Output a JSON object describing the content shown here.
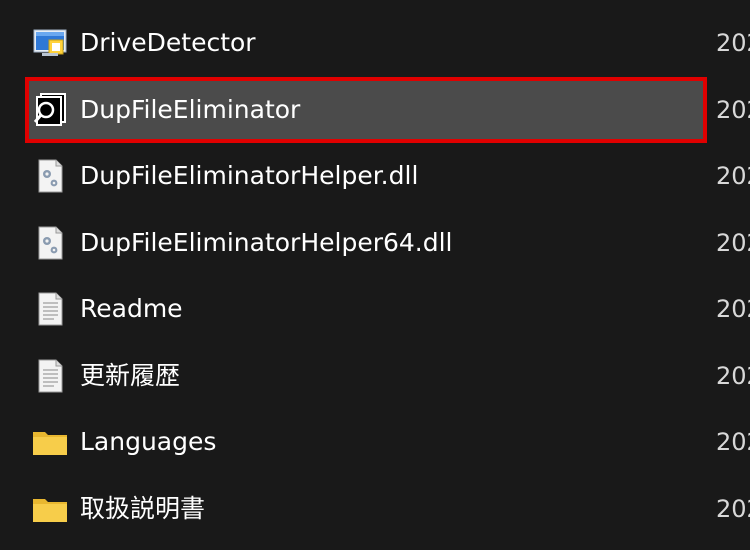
{
  "files": [
    {
      "name": "DriveDetector",
      "date": "202",
      "icon": "drive-detector-app-icon",
      "selected": false
    },
    {
      "name": "DupFileEliminator",
      "date": "202",
      "icon": "dupfileeliminator-app-icon",
      "selected": true
    },
    {
      "name": "DupFileEliminatorHelper.dll",
      "date": "202",
      "icon": "dll-gear-icon",
      "selected": false
    },
    {
      "name": "DupFileEliminatorHelper64.dll",
      "date": "202",
      "icon": "dll-gear-icon",
      "selected": false
    },
    {
      "name": "Readme",
      "date": "202",
      "icon": "text-file-icon",
      "selected": false
    },
    {
      "name": "更新履歴",
      "date": "202",
      "icon": "text-file-icon",
      "selected": false
    },
    {
      "name": "Languages",
      "date": "202",
      "icon": "folder-icon",
      "selected": false
    },
    {
      "name": "取扱説明書",
      "date": "202",
      "icon": "folder-icon",
      "selected": false
    }
  ],
  "colors": {
    "background": "#191919",
    "selected_row": "#4b4b4b",
    "highlight_border": "#e00000",
    "folder": "#f4c542"
  }
}
